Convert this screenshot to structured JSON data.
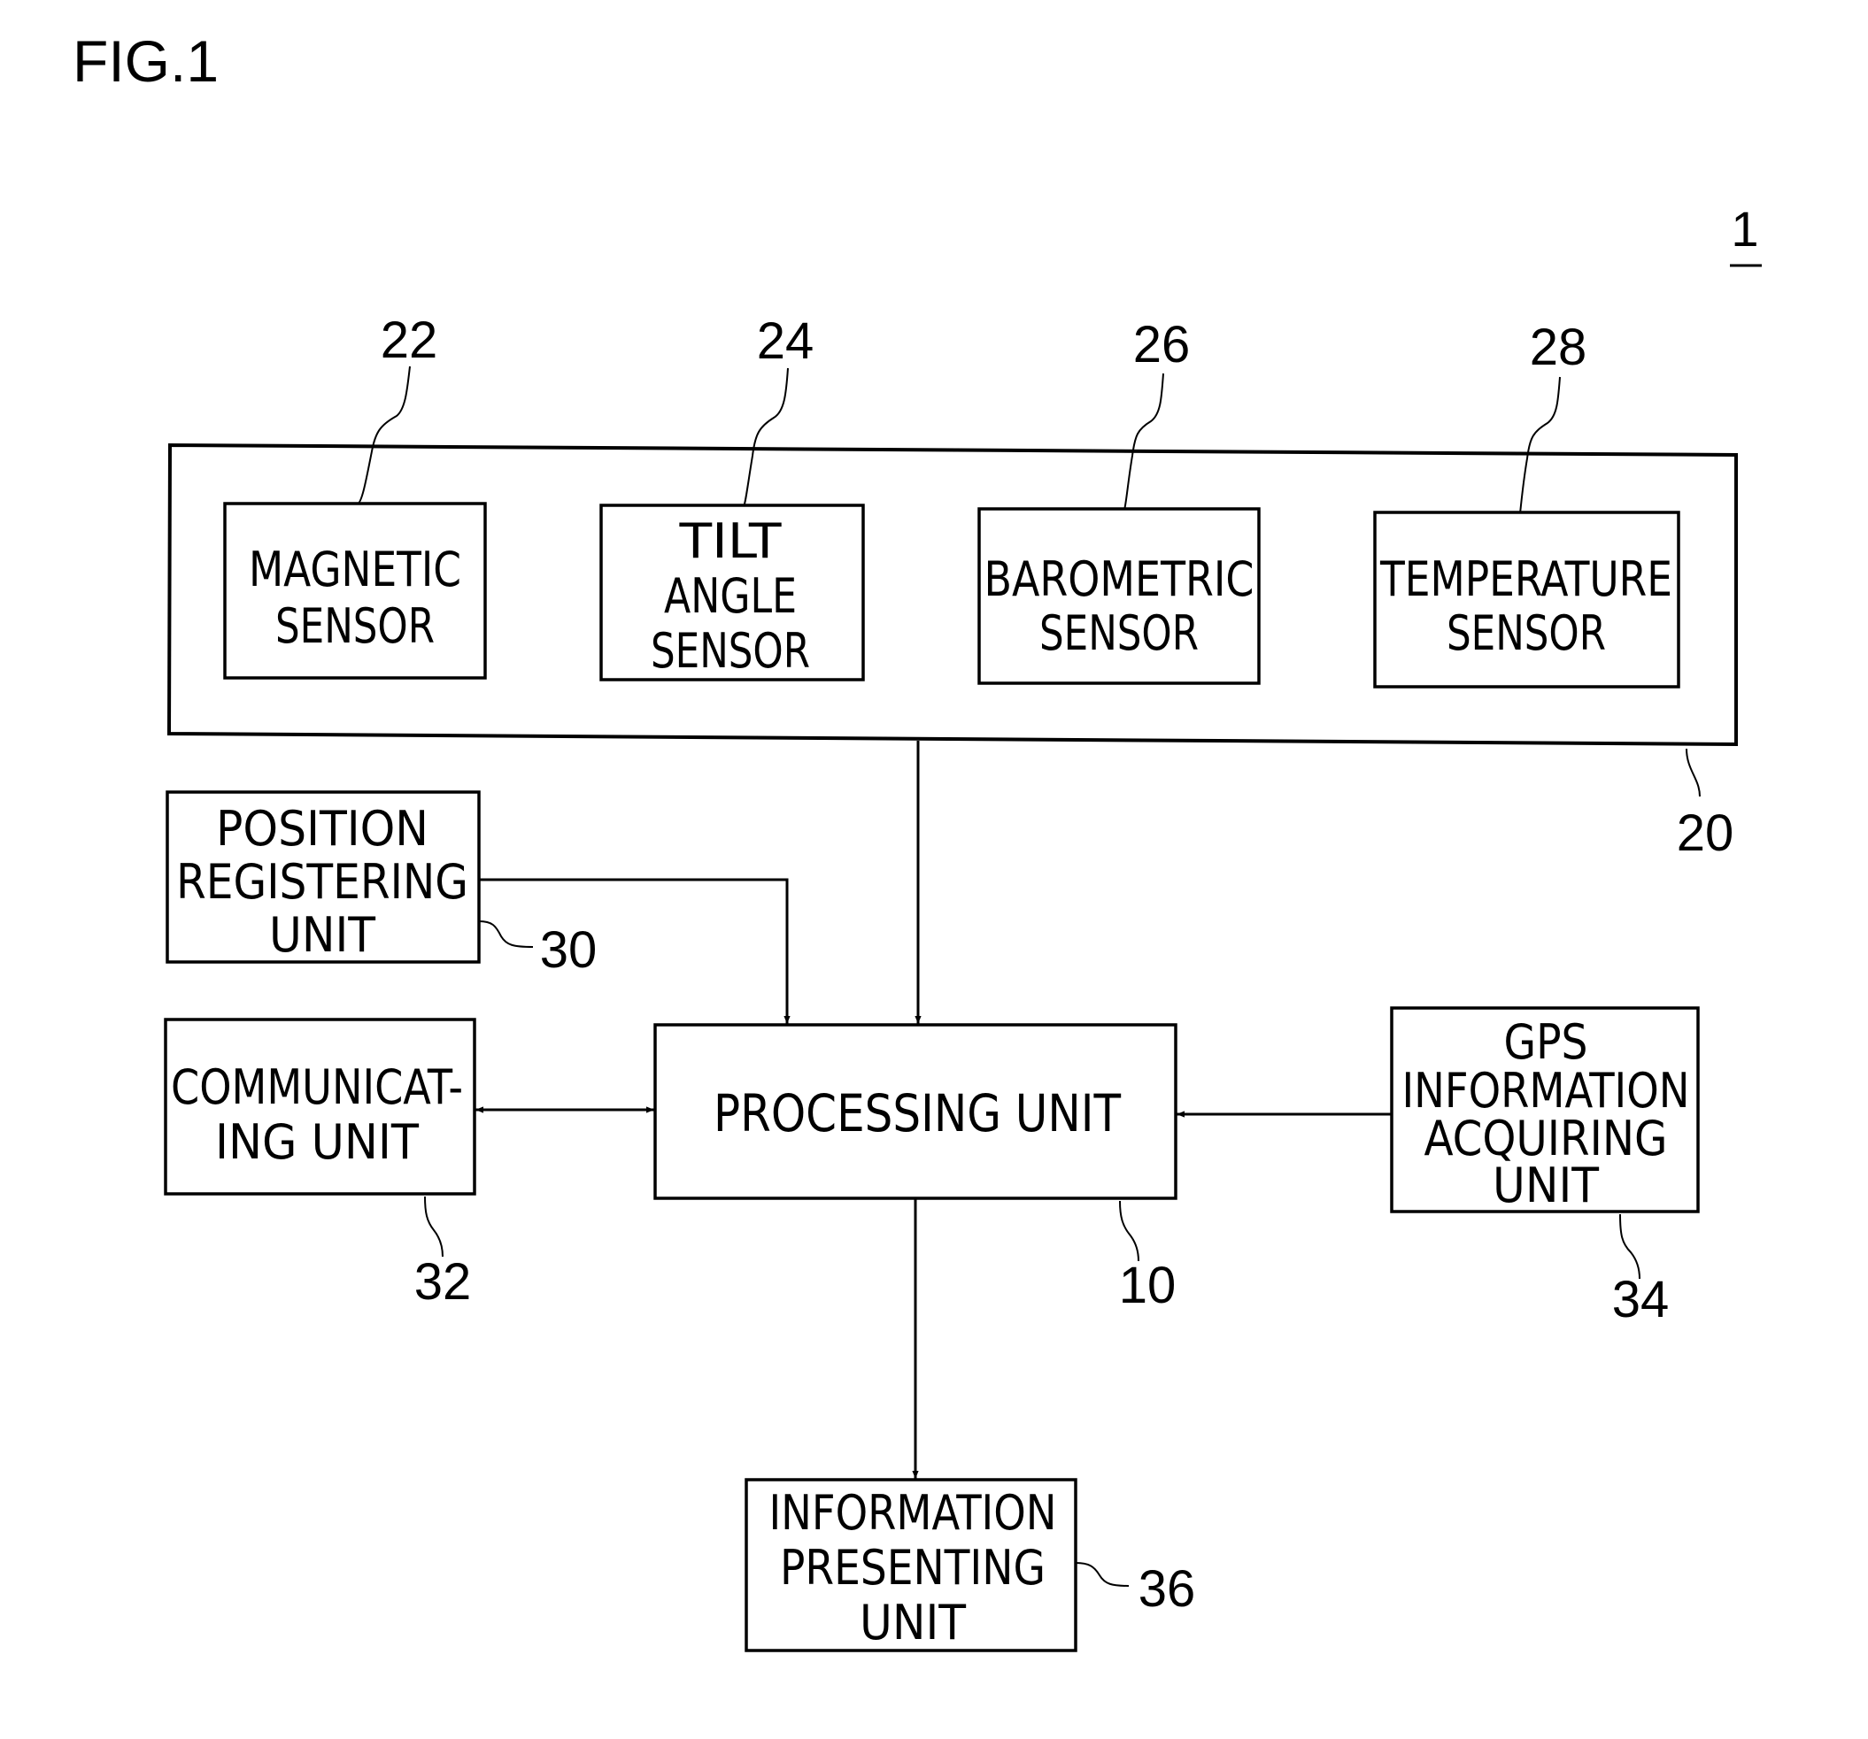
{
  "figure": {
    "title": "FIG.1",
    "device_ref": "1"
  },
  "blocks": {
    "sensor_group": {
      "ref": "20"
    },
    "magnetic_sensor": {
      "ref": "22",
      "lines": [
        "MAGNETIC",
        "SENSOR"
      ]
    },
    "tilt_angle_sensor": {
      "ref": "24",
      "lines": [
        "TILT",
        "ANGLE",
        "SENSOR"
      ]
    },
    "barometric_sensor": {
      "ref": "26",
      "lines": [
        "BAROMETRIC",
        "SENSOR"
      ]
    },
    "temperature_sensor": {
      "ref": "28",
      "lines": [
        "TEMPERATURE",
        "SENSOR"
      ]
    },
    "position_registering_unit": {
      "ref": "30",
      "lines": [
        "POSITION",
        "REGISTERING",
        "UNIT"
      ]
    },
    "communicating_unit": {
      "ref": "32",
      "lines": [
        "COMMUNICAT-",
        "ING UNIT"
      ]
    },
    "processing_unit": {
      "ref": "10",
      "lines": [
        "PROCESSING UNIT"
      ]
    },
    "gps_information_acquiring_unit": {
      "ref": "34",
      "lines": [
        "GPS",
        "INFORMATION",
        "ACQUIRING",
        "UNIT"
      ]
    },
    "information_presenting_unit": {
      "ref": "36",
      "lines": [
        "INFORMATION",
        "PRESENTING",
        "UNIT"
      ]
    }
  },
  "connections": [
    {
      "from": "sensor_group",
      "to": "processing_unit",
      "type": "one-way"
    },
    {
      "from": "position_registering_unit",
      "to": "processing_unit",
      "type": "one-way"
    },
    {
      "from": "communicating_unit",
      "to": "processing_unit",
      "type": "two-way"
    },
    {
      "from": "gps_information_acquiring_unit",
      "to": "processing_unit",
      "type": "one-way"
    },
    {
      "from": "processing_unit",
      "to": "information_presenting_unit",
      "type": "one-way"
    }
  ]
}
